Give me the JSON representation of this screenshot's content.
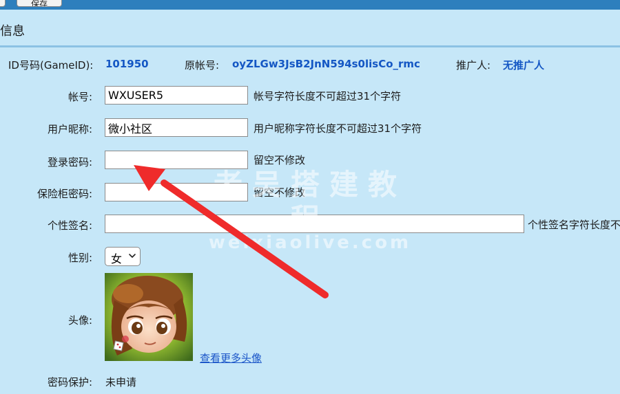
{
  "toolbar": {
    "main_button_label": "保存"
  },
  "section": {
    "title": "信息"
  },
  "info": {
    "game_id_label": "ID号码(GameID):",
    "game_id_value": "101950",
    "original_account_label": "原帐号:",
    "original_account_value": "oyZLGw3JsB2JnN594s0lisCo_rmc",
    "referrer_label": "推广人:",
    "referrer_value": "无推广人"
  },
  "form": {
    "account": {
      "label": "帐号:",
      "value": "WXUSER5",
      "hint": "帐号字符长度不可超过31个字符"
    },
    "nickname": {
      "label": "用户昵称:",
      "value": "微小社区",
      "hint": "用户昵称字符长度不可超过31个字符"
    },
    "login_password": {
      "label": "登录密码:",
      "value": "",
      "hint": "留空不修改"
    },
    "vault_password": {
      "label": "保险柜密码:",
      "value": "",
      "hint": "留空不修改"
    },
    "signature": {
      "label": "个性签名:",
      "value": "",
      "hint": "个性签名字符长度不"
    },
    "gender": {
      "label": "性别:",
      "selected": "女"
    },
    "avatar": {
      "label": "头像:",
      "more_link": "查看更多头像"
    },
    "password_protection": {
      "label": "密码保护:",
      "value": "未申请"
    }
  },
  "watermark": {
    "line1": "老吴搭建教程",
    "line2": "weixiaolive.com"
  },
  "colors": {
    "background": "#c6e7f8",
    "value_blue": "#1457c4",
    "link_blue": "#1a55c8",
    "arrow_red": "#ef2b2b"
  }
}
